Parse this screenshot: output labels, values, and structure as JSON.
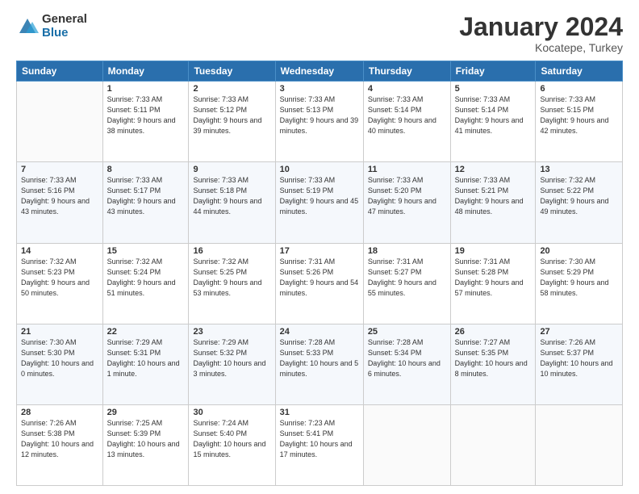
{
  "logo": {
    "general": "General",
    "blue": "Blue"
  },
  "header": {
    "month": "January 2024",
    "location": "Kocatepe, Turkey"
  },
  "weekdays": [
    "Sunday",
    "Monday",
    "Tuesday",
    "Wednesday",
    "Thursday",
    "Friday",
    "Saturday"
  ],
  "weeks": [
    [
      {
        "day": "",
        "info": ""
      },
      {
        "day": "1",
        "info": "Sunrise: 7:33 AM\nSunset: 5:11 PM\nDaylight: 9 hours\nand 38 minutes."
      },
      {
        "day": "2",
        "info": "Sunrise: 7:33 AM\nSunset: 5:12 PM\nDaylight: 9 hours\nand 39 minutes."
      },
      {
        "day": "3",
        "info": "Sunrise: 7:33 AM\nSunset: 5:13 PM\nDaylight: 9 hours\nand 39 minutes."
      },
      {
        "day": "4",
        "info": "Sunrise: 7:33 AM\nSunset: 5:14 PM\nDaylight: 9 hours\nand 40 minutes."
      },
      {
        "day": "5",
        "info": "Sunrise: 7:33 AM\nSunset: 5:14 PM\nDaylight: 9 hours\nand 41 minutes."
      },
      {
        "day": "6",
        "info": "Sunrise: 7:33 AM\nSunset: 5:15 PM\nDaylight: 9 hours\nand 42 minutes."
      }
    ],
    [
      {
        "day": "7",
        "info": "Sunrise: 7:33 AM\nSunset: 5:16 PM\nDaylight: 9 hours\nand 43 minutes."
      },
      {
        "day": "8",
        "info": "Sunrise: 7:33 AM\nSunset: 5:17 PM\nDaylight: 9 hours\nand 43 minutes."
      },
      {
        "day": "9",
        "info": "Sunrise: 7:33 AM\nSunset: 5:18 PM\nDaylight: 9 hours\nand 44 minutes."
      },
      {
        "day": "10",
        "info": "Sunrise: 7:33 AM\nSunset: 5:19 PM\nDaylight: 9 hours\nand 45 minutes."
      },
      {
        "day": "11",
        "info": "Sunrise: 7:33 AM\nSunset: 5:20 PM\nDaylight: 9 hours\nand 47 minutes."
      },
      {
        "day": "12",
        "info": "Sunrise: 7:33 AM\nSunset: 5:21 PM\nDaylight: 9 hours\nand 48 minutes."
      },
      {
        "day": "13",
        "info": "Sunrise: 7:32 AM\nSunset: 5:22 PM\nDaylight: 9 hours\nand 49 minutes."
      }
    ],
    [
      {
        "day": "14",
        "info": "Sunrise: 7:32 AM\nSunset: 5:23 PM\nDaylight: 9 hours\nand 50 minutes."
      },
      {
        "day": "15",
        "info": "Sunrise: 7:32 AM\nSunset: 5:24 PM\nDaylight: 9 hours\nand 51 minutes."
      },
      {
        "day": "16",
        "info": "Sunrise: 7:32 AM\nSunset: 5:25 PM\nDaylight: 9 hours\nand 53 minutes."
      },
      {
        "day": "17",
        "info": "Sunrise: 7:31 AM\nSunset: 5:26 PM\nDaylight: 9 hours\nand 54 minutes."
      },
      {
        "day": "18",
        "info": "Sunrise: 7:31 AM\nSunset: 5:27 PM\nDaylight: 9 hours\nand 55 minutes."
      },
      {
        "day": "19",
        "info": "Sunrise: 7:31 AM\nSunset: 5:28 PM\nDaylight: 9 hours\nand 57 minutes."
      },
      {
        "day": "20",
        "info": "Sunrise: 7:30 AM\nSunset: 5:29 PM\nDaylight: 9 hours\nand 58 minutes."
      }
    ],
    [
      {
        "day": "21",
        "info": "Sunrise: 7:30 AM\nSunset: 5:30 PM\nDaylight: 10 hours\nand 0 minutes."
      },
      {
        "day": "22",
        "info": "Sunrise: 7:29 AM\nSunset: 5:31 PM\nDaylight: 10 hours\nand 1 minute."
      },
      {
        "day": "23",
        "info": "Sunrise: 7:29 AM\nSunset: 5:32 PM\nDaylight: 10 hours\nand 3 minutes."
      },
      {
        "day": "24",
        "info": "Sunrise: 7:28 AM\nSunset: 5:33 PM\nDaylight: 10 hours\nand 5 minutes."
      },
      {
        "day": "25",
        "info": "Sunrise: 7:28 AM\nSunset: 5:34 PM\nDaylight: 10 hours\nand 6 minutes."
      },
      {
        "day": "26",
        "info": "Sunrise: 7:27 AM\nSunset: 5:35 PM\nDaylight: 10 hours\nand 8 minutes."
      },
      {
        "day": "27",
        "info": "Sunrise: 7:26 AM\nSunset: 5:37 PM\nDaylight: 10 hours\nand 10 minutes."
      }
    ],
    [
      {
        "day": "28",
        "info": "Sunrise: 7:26 AM\nSunset: 5:38 PM\nDaylight: 10 hours\nand 12 minutes."
      },
      {
        "day": "29",
        "info": "Sunrise: 7:25 AM\nSunset: 5:39 PM\nDaylight: 10 hours\nand 13 minutes."
      },
      {
        "day": "30",
        "info": "Sunrise: 7:24 AM\nSunset: 5:40 PM\nDaylight: 10 hours\nand 15 minutes."
      },
      {
        "day": "31",
        "info": "Sunrise: 7:23 AM\nSunset: 5:41 PM\nDaylight: 10 hours\nand 17 minutes."
      },
      {
        "day": "",
        "info": ""
      },
      {
        "day": "",
        "info": ""
      },
      {
        "day": "",
        "info": ""
      }
    ]
  ]
}
